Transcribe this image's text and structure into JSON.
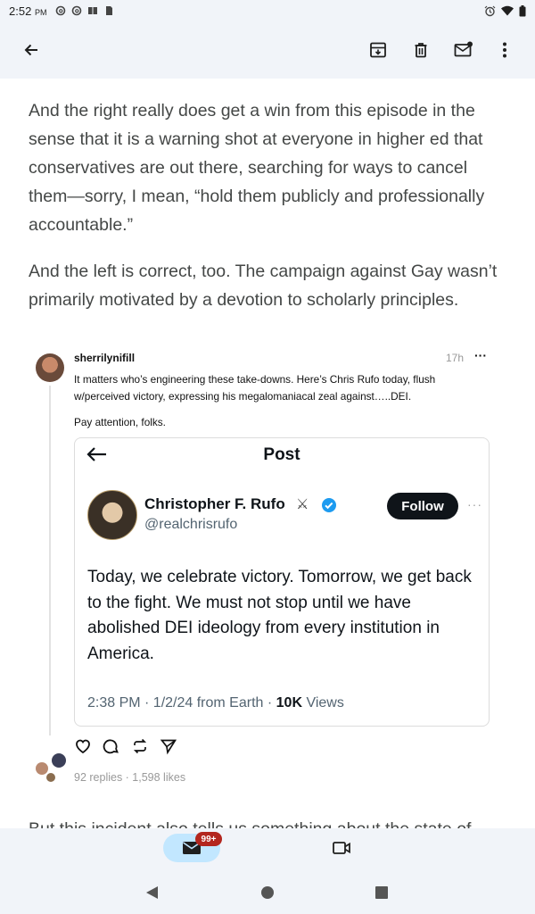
{
  "status_bar": {
    "time": "2:52",
    "ampm": "PM",
    "left_icons": [
      "threads-icon",
      "threads-icon",
      "book-icon",
      "sd-card-icon"
    ],
    "right_icons": [
      "alarm-icon",
      "wifi-icon",
      "battery-icon"
    ]
  },
  "app_bar": {
    "icons": [
      "back-arrow-icon",
      "archive-icon",
      "delete-icon",
      "mark-unread-icon",
      "more-vert-icon"
    ]
  },
  "body": {
    "paragraph1": "And the right really does get a win from this episode in the sense that it is a warning shot at everyone in higher ed that conservatives are out there, searching for ways to cancel them—sorry, I mean, “hold them publicly and professionally accountable.”",
    "paragraph2": "And the left is correct, too. The campaign against Gay wasn’t primarily motivated by a devotion to scholarly principles.",
    "cut_off_text": "But this incident also tells us something about the state of"
  },
  "embed": {
    "author": "sherrilynifill",
    "time_ago": "17h",
    "more": "···",
    "text": "It matters who’s engineering these take-downs. Here’s Chris Rufo today, flush w/perceived victory, expressing his megalomaniacal zeal against…..DEI.",
    "text2": "Pay attention, folks.",
    "stats": "92 replies · 1,598 likes",
    "card": {
      "title": "Post",
      "name": "Christopher F. Rufo",
      "handle": "@realchrisrufo",
      "follow_label": "Follow",
      "dots": "···",
      "tweet": "Today, we celebrate victory. Tomorrow, we get back to the fight. We must not stop until we have abolished DEI ideology from every institution in America.",
      "meta_prefix": "2:38 PM · 1/2/24 from Earth · ",
      "views_count": "10K",
      "views_label": " Views"
    }
  },
  "bottom_nav": {
    "mail_badge": "99+"
  },
  "colors": {
    "surface": "#f1f4f9",
    "mail_pill": "#c2e7ff",
    "badge": "#b3261e",
    "follow": "#0f1419",
    "verified": "#1d9bf0"
  }
}
